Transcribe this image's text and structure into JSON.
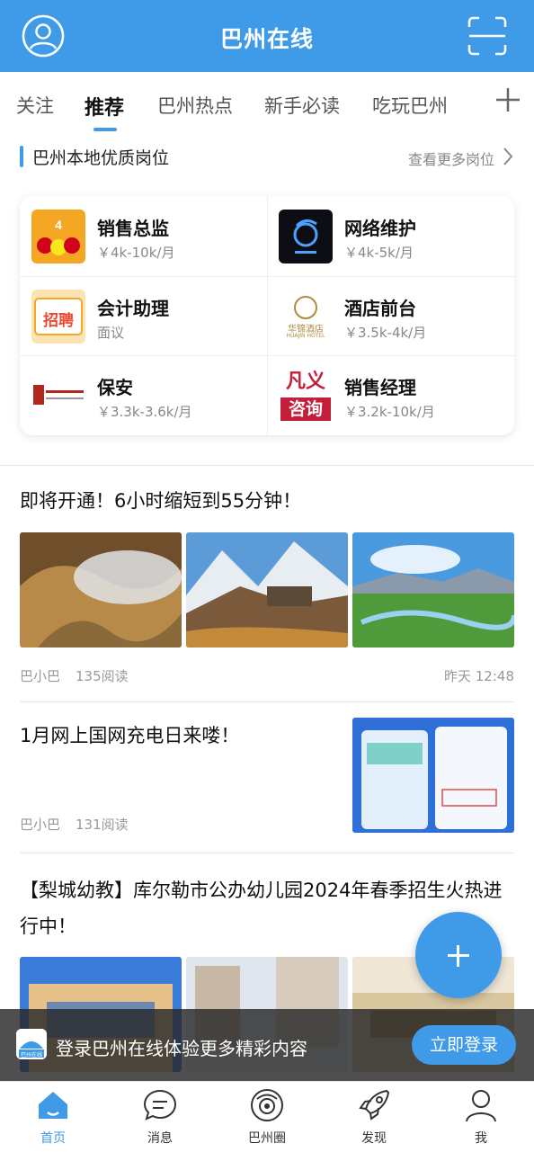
{
  "header": {
    "title": "巴州在线"
  },
  "tabs": [
    "关注",
    "推荐",
    "巴州热点",
    "新手必读",
    "吃玩巴州"
  ],
  "jobs_section": {
    "title": "巴州本地优质岗位",
    "more": "查看更多岗位"
  },
  "jobs": [
    {
      "name": "销售总监",
      "salary": "￥4k-10k/月"
    },
    {
      "name": "网络维护",
      "salary": "￥4k-5k/月"
    },
    {
      "name": "会计助理",
      "salary": "面议"
    },
    {
      "name": "酒店前台",
      "salary": "￥3.5k-4k/月"
    },
    {
      "name": "保安",
      "salary": "￥3.3k-3.6k/月"
    },
    {
      "name": "销售经理",
      "salary": "￥3.2k-10k/月"
    }
  ],
  "logo_text": {
    "zhaopin": "招聘",
    "fanyi": "凡义",
    "zixun": "咨询",
    "huajin": "华锦酒店",
    "huajin_en": "HUAJIN HOTEL"
  },
  "articles": [
    {
      "title": "即将开通！6小时缩短到55分钟！",
      "author": "巴小巴",
      "reads": "135阅读",
      "time": "昨天 12:48"
    },
    {
      "title": "1月网上国网充电日来喽！",
      "author": "巴小巴",
      "reads": "131阅读"
    },
    {
      "title_line1": "【梨城幼教】库尔勒市公办幼儿园2024年春季招生火热进",
      "title_line2": "行中！"
    }
  ],
  "login_bar": {
    "text": "登录巴州在线体验更多精彩内容",
    "button": "立即登录",
    "logo_label": "巴州在线"
  },
  "bottom_nav": [
    "首页",
    "消息",
    "巴州圈",
    "发现",
    "我"
  ],
  "colors": {
    "primary": "#3f9ae8"
  }
}
